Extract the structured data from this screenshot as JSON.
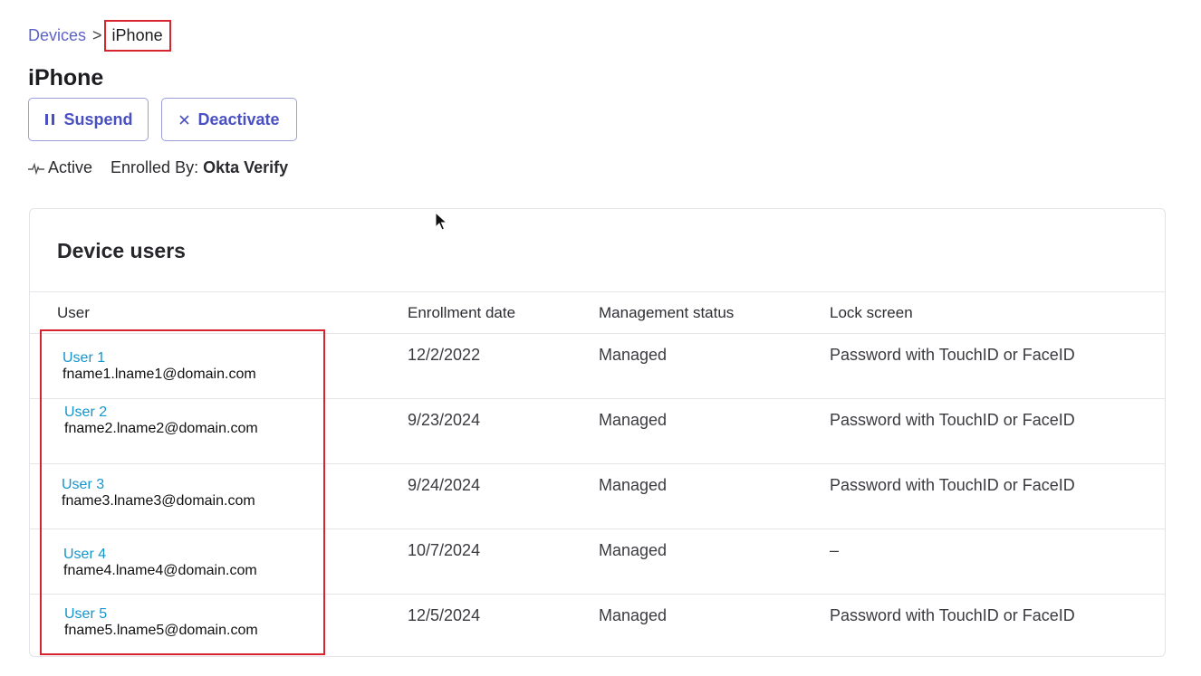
{
  "breadcrumb": {
    "parent": "Devices",
    "separator": ">",
    "current": "iPhone"
  },
  "page_title": "iPhone",
  "actions": {
    "suspend_label": "Suspend",
    "deactivate_label": "Deactivate"
  },
  "status": {
    "state": "Active",
    "enrolled_by_label": "Enrolled By:",
    "enrolled_by_value": "Okta Verify"
  },
  "device_users": {
    "title": "Device users",
    "columns": [
      "User",
      "Enrollment date",
      "Management status",
      "Lock screen"
    ],
    "rows": [
      {
        "user": "User 1",
        "email": "fname1.lname1@domain.com",
        "date": "12/2/2022",
        "status": "Managed",
        "lock": "Password with TouchID or FaceID"
      },
      {
        "user": "User 2",
        "email": "fname2.lname2@domain.com",
        "date": "9/23/2024",
        "status": "Managed",
        "lock": "Password with TouchID or FaceID"
      },
      {
        "user": "User 3",
        "email": "fname3.lname3@domain.com",
        "date": "9/24/2024",
        "status": "Managed",
        "lock": "Password with TouchID or FaceID"
      },
      {
        "user": "User 4",
        "email": "fname4.lname4@domain.com",
        "date": "10/7/2024",
        "status": "Managed",
        "lock": "–"
      },
      {
        "user": "User 5",
        "email": "fname5.lname5@domain.com",
        "date": "12/5/2024",
        "status": "Managed",
        "lock": "Password with TouchID or FaceID"
      }
    ]
  },
  "icons": {
    "suspend": "pause-icon",
    "deactivate": "close-icon",
    "status": "activity-pulse-icon",
    "cursor": "mouse-pointer-icon"
  },
  "colors": {
    "accent": "#4a50c2",
    "link": "#1596cc",
    "highlight": "#d8242f"
  }
}
